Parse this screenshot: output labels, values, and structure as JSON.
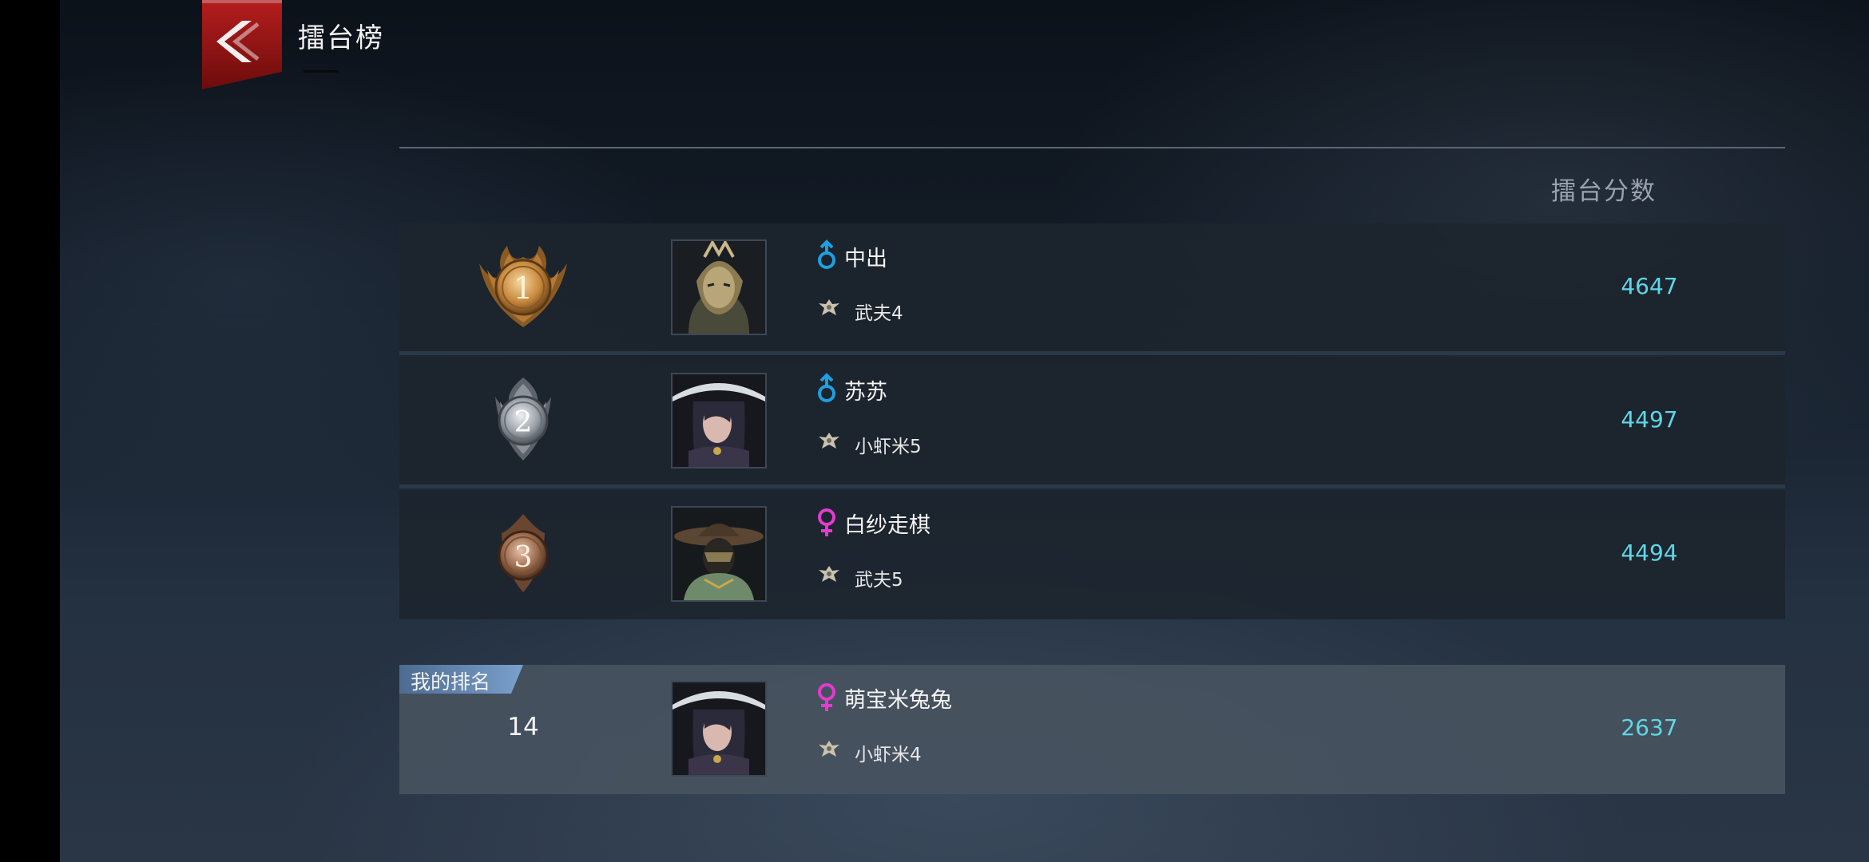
{
  "header": {
    "title": "擂台榜",
    "back_icon": "back-arrow-icon"
  },
  "table": {
    "score_header": "擂台分数"
  },
  "rankings": [
    {
      "rank": "1",
      "medal": "gold",
      "name": "中出",
      "gender": "male",
      "team": "武夫4",
      "score": "4647"
    },
    {
      "rank": "2",
      "medal": "silver",
      "name": "苏苏",
      "gender": "male",
      "team": "小虾米5",
      "score": "4497"
    },
    {
      "rank": "3",
      "medal": "bronze",
      "name": "白纱走棋",
      "gender": "female",
      "team": "武夫5",
      "score": "4494"
    }
  ],
  "my_rank": {
    "tag": "我的排名",
    "rank": "14",
    "name": "萌宝米兔兔",
    "gender": "female",
    "team": "小虾米4",
    "score": "2637"
  },
  "colors": {
    "male": "#1e9fe0",
    "female": "#e23ccf",
    "score": "#5fd6e6",
    "gold": "#c98a3e",
    "silver": "#9aa0a8",
    "bronze": "#9a6a4c",
    "back_button": "#8e1313"
  }
}
